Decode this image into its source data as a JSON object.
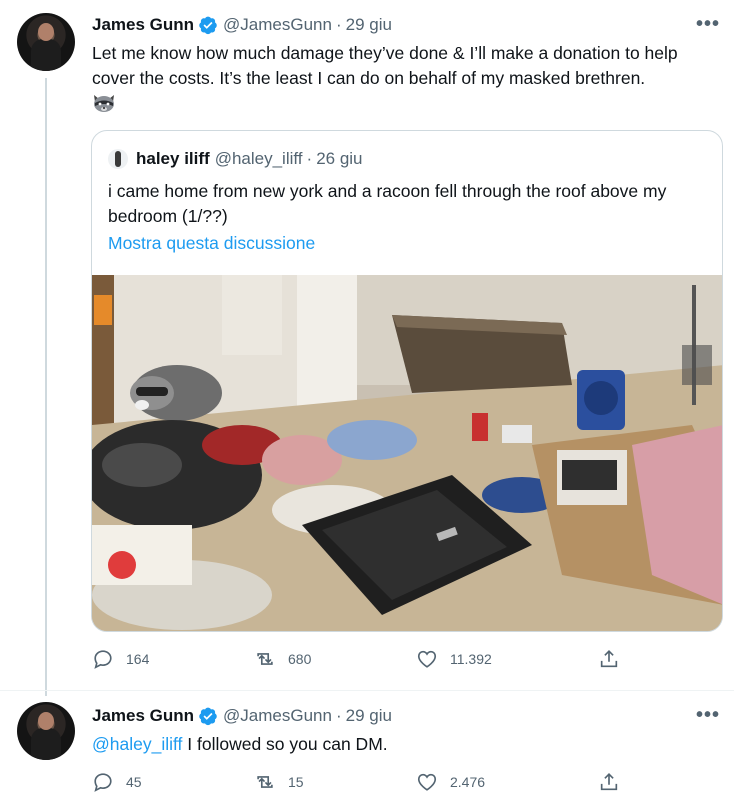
{
  "tweet1": {
    "name": "James Gunn",
    "handle": "@JamesGunn",
    "separator": "·",
    "time": "29 giu",
    "more": "•••",
    "text": "Let me know how much damage they’ve done & I’ll make a donation to help cover the costs. It’s the least I can do on behalf of my masked brethren.",
    "emoji_icon": "raccoon-emoji",
    "quote": {
      "name": "haley iliff",
      "handle": "@haley_iliff",
      "separator": "·",
      "time": "26 giu",
      "text": "i came home from new york and a racoon fell through the roof above my bedroom (1/??)",
      "show_thread": "Mostra questa discussione"
    },
    "replies": "164",
    "retweets": "680",
    "likes": "11.392"
  },
  "tweet2": {
    "name": "James Gunn",
    "handle": "@JamesGunn",
    "separator": "·",
    "time": "29 giu",
    "more": "•••",
    "mention": "@haley_iliff",
    "text": " I followed so you can DM.",
    "replies": "45",
    "retweets": "15",
    "likes": "2.476"
  },
  "colors": {
    "accent": "#1d9bf0",
    "secondary_text": "#536471",
    "border": "#cfd9de"
  }
}
